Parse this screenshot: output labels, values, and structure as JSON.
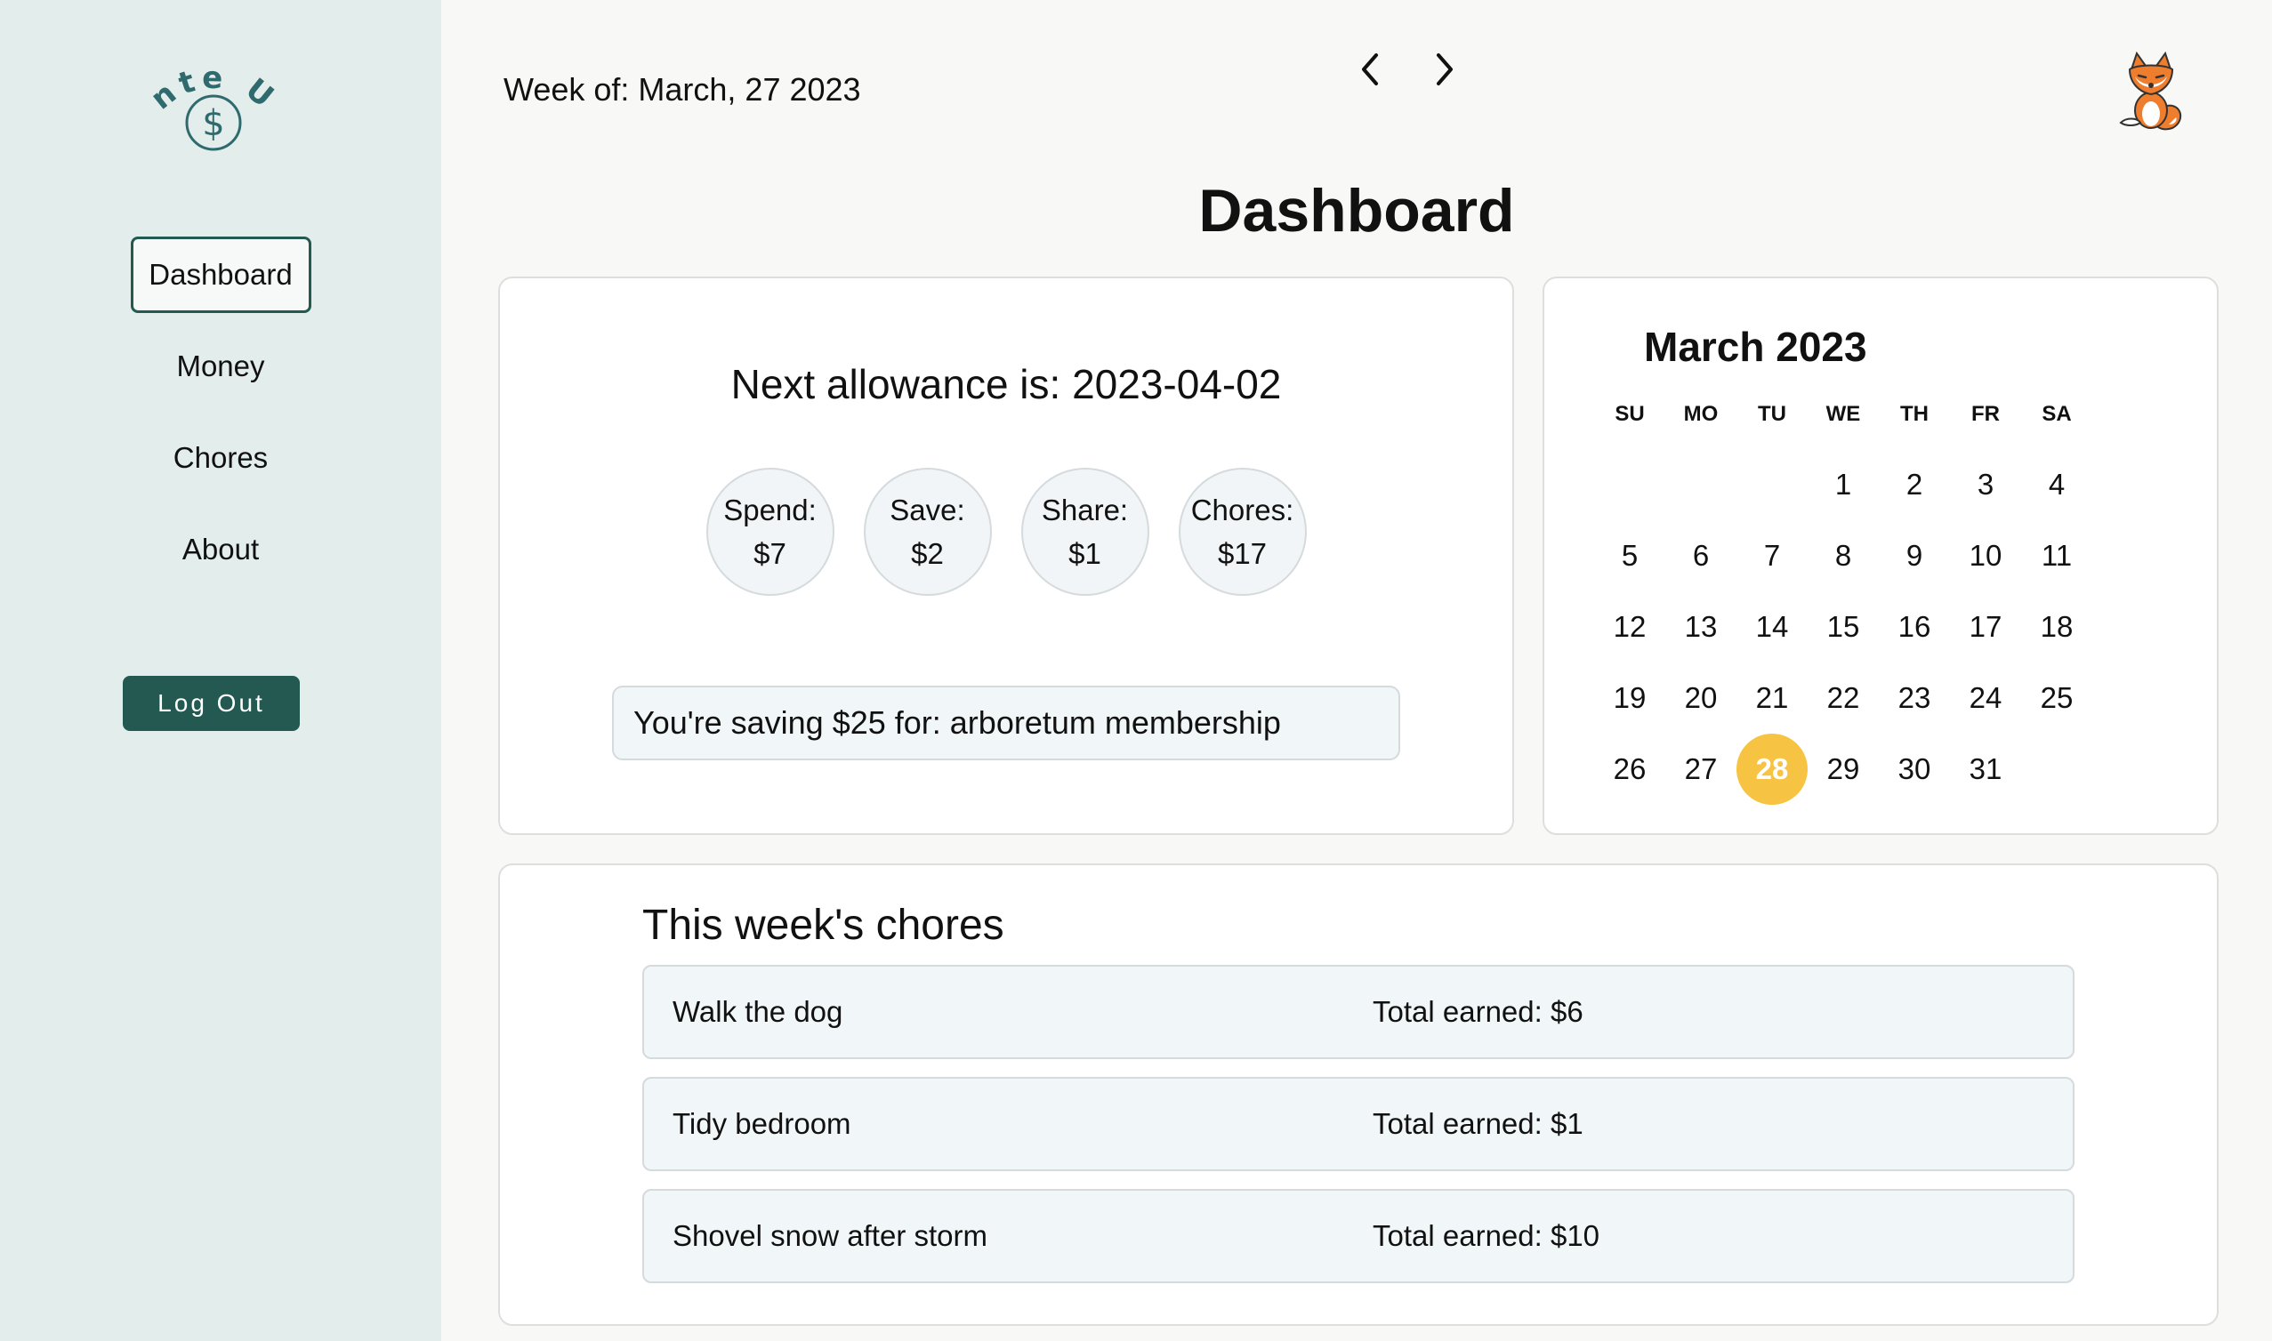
{
  "logo": {
    "text": "Ante Up",
    "symbol": "$"
  },
  "sidebar": {
    "items": [
      {
        "label": "Dashboard",
        "active": true
      },
      {
        "label": "Money",
        "active": false
      },
      {
        "label": "Chores",
        "active": false
      },
      {
        "label": "About",
        "active": false
      }
    ],
    "logout_label": "Log Out"
  },
  "header": {
    "week_label": "Week of: March, 27 2023",
    "avatar_icon": "fox-avatar-icon"
  },
  "page": {
    "title": "Dashboard"
  },
  "allowance": {
    "heading": "Next allowance is: 2023-04-02",
    "buckets": [
      {
        "label": "Spend:",
        "value": "$7"
      },
      {
        "label": "Save:",
        "value": "$2"
      },
      {
        "label": "Share:",
        "value": "$1"
      },
      {
        "label": "Chores:",
        "value": "$17"
      }
    ],
    "saving_goal": "You're saving $25 for: arboretum membership"
  },
  "calendar": {
    "month_label": "March 2023",
    "prev_icon": "chevron-left-icon",
    "next_icon": "chevron-right-icon",
    "weekdays": [
      "SU",
      "MO",
      "TU",
      "WE",
      "TH",
      "FR",
      "SA"
    ],
    "first_weekday_index": 3,
    "days_in_month": 31,
    "today": 28,
    "today_color": "#f6c343"
  },
  "chores": {
    "heading": "This week's chores",
    "items": [
      {
        "name": "Walk the dog",
        "earned": "Total earned: $6"
      },
      {
        "name": "Tidy bedroom",
        "earned": "Total earned: $1"
      },
      {
        "name": "Shovel snow after storm",
        "earned": "Total earned: $10"
      }
    ]
  },
  "colors": {
    "accent": "#245952",
    "sidebar_bg": "#e3eeec",
    "highlight": "#f6c343"
  }
}
